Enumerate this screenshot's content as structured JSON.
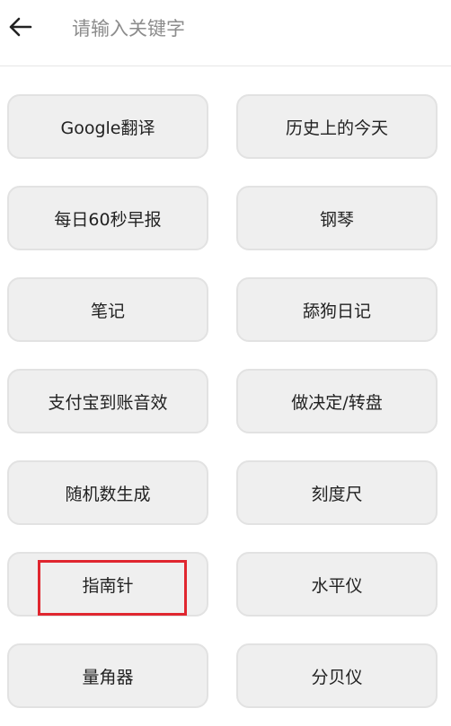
{
  "header": {
    "back_icon": "arrow-left-icon",
    "search_placeholder": "请输入关键字"
  },
  "tools": [
    {
      "label": "Google翻译",
      "highlighted": false
    },
    {
      "label": "历史上的今天",
      "highlighted": false
    },
    {
      "label": "每日60秒早报",
      "highlighted": false
    },
    {
      "label": "钢琴",
      "highlighted": false
    },
    {
      "label": "笔记",
      "highlighted": false
    },
    {
      "label": "舔狗日记",
      "highlighted": false
    },
    {
      "label": "支付宝到账音效",
      "highlighted": false
    },
    {
      "label": "做决定/转盘",
      "highlighted": false
    },
    {
      "label": "随机数生成",
      "highlighted": false
    },
    {
      "label": "刻度尺",
      "highlighted": false
    },
    {
      "label": "指南针",
      "highlighted": true
    },
    {
      "label": "水平仪",
      "highlighted": false
    },
    {
      "label": "量角器",
      "highlighted": false
    },
    {
      "label": "分贝仪",
      "highlighted": false
    }
  ],
  "colors": {
    "highlight_border": "#e0262f",
    "button_bg": "#efefef"
  }
}
